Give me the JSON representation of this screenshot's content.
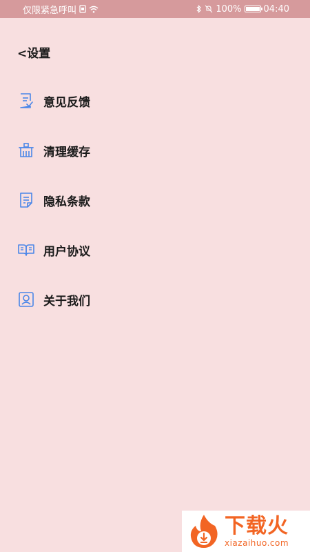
{
  "status_bar": {
    "carrier": "仅限紧急呼叫",
    "battery": "100%",
    "battery_level": 1.0,
    "time": "04:40"
  },
  "header": {
    "back_label": "<设置"
  },
  "menu": {
    "items": [
      {
        "label": "意见反馈",
        "icon": "feedback-icon"
      },
      {
        "label": "清理缓存",
        "icon": "basket-icon"
      },
      {
        "label": "隐私条款",
        "icon": "document-icon"
      },
      {
        "label": "用户协议",
        "icon": "book-icon"
      },
      {
        "label": "关于我们",
        "icon": "contact-icon"
      }
    ]
  },
  "watermark": {
    "brand": "下载火",
    "domain": "xiazaihuo.com"
  },
  "colors": {
    "background": "#f8dfe0",
    "status_bar": "#d69a9c",
    "icon_blue": "#4a86e8",
    "text": "#1a1a1a",
    "watermark_orange": "#f26524"
  }
}
